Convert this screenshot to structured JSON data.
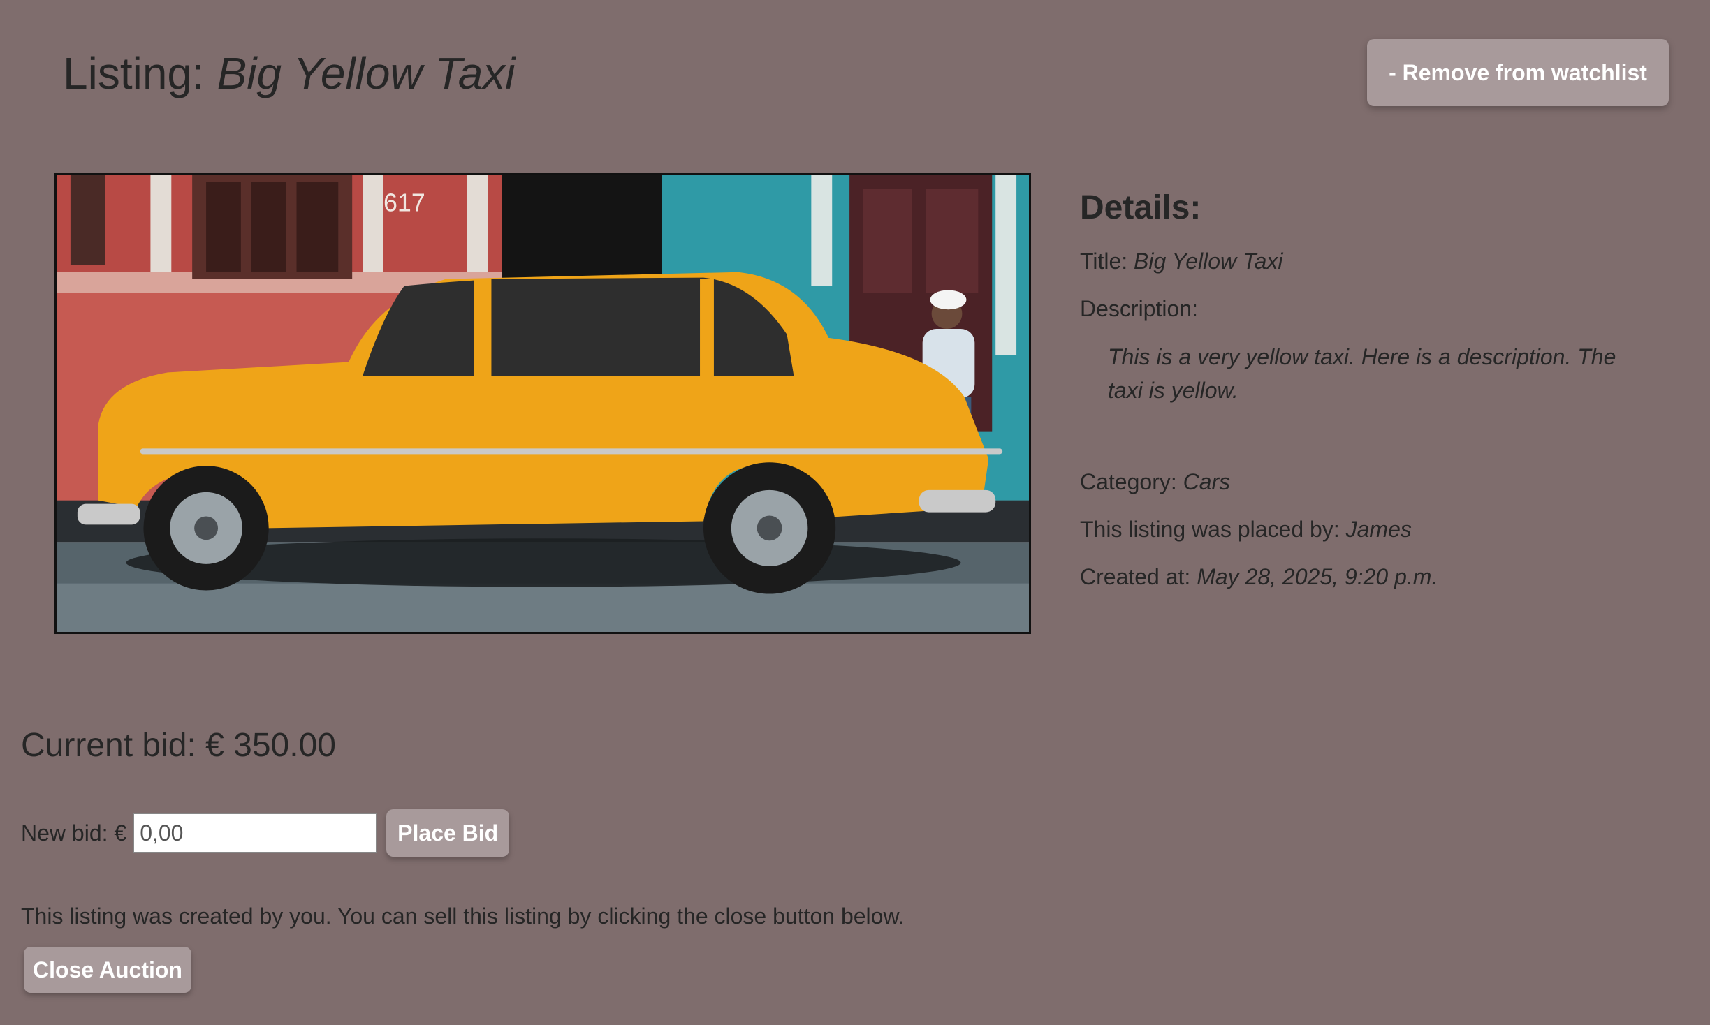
{
  "header": {
    "title_prefix": "Listing: ",
    "title_name": "Big Yellow Taxi",
    "watchlist_button": "- Remove from watchlist"
  },
  "image": {
    "subject": "yellow vintage taxi car parked in front of colorful building",
    "house_number": "617"
  },
  "details": {
    "heading": "Details:",
    "title_label": "Title: ",
    "title_value": "Big Yellow Taxi",
    "description_label": "Description:",
    "description_value": "This is a very yellow taxi. Here is a description. The taxi is yellow.",
    "category_label": "Category: ",
    "category_value": "Cars",
    "placed_by_label": "This listing was placed by: ",
    "placed_by_value": "James",
    "created_label": "Created at: ",
    "created_value": "May 28, 2025, 9:20 p.m."
  },
  "bid": {
    "current_bid": "Current bid: € 350.00",
    "new_bid_label": "New bid: €",
    "new_bid_placeholder": "0,00",
    "place_bid_button": "Place Bid"
  },
  "owner": {
    "note": "This listing was created by you. You can sell this listing by clicking the close button below.",
    "close_button": "Close Auction"
  },
  "colors": {
    "background": "#7f6d6d",
    "button": "#a89a9b",
    "text": "#262626"
  }
}
